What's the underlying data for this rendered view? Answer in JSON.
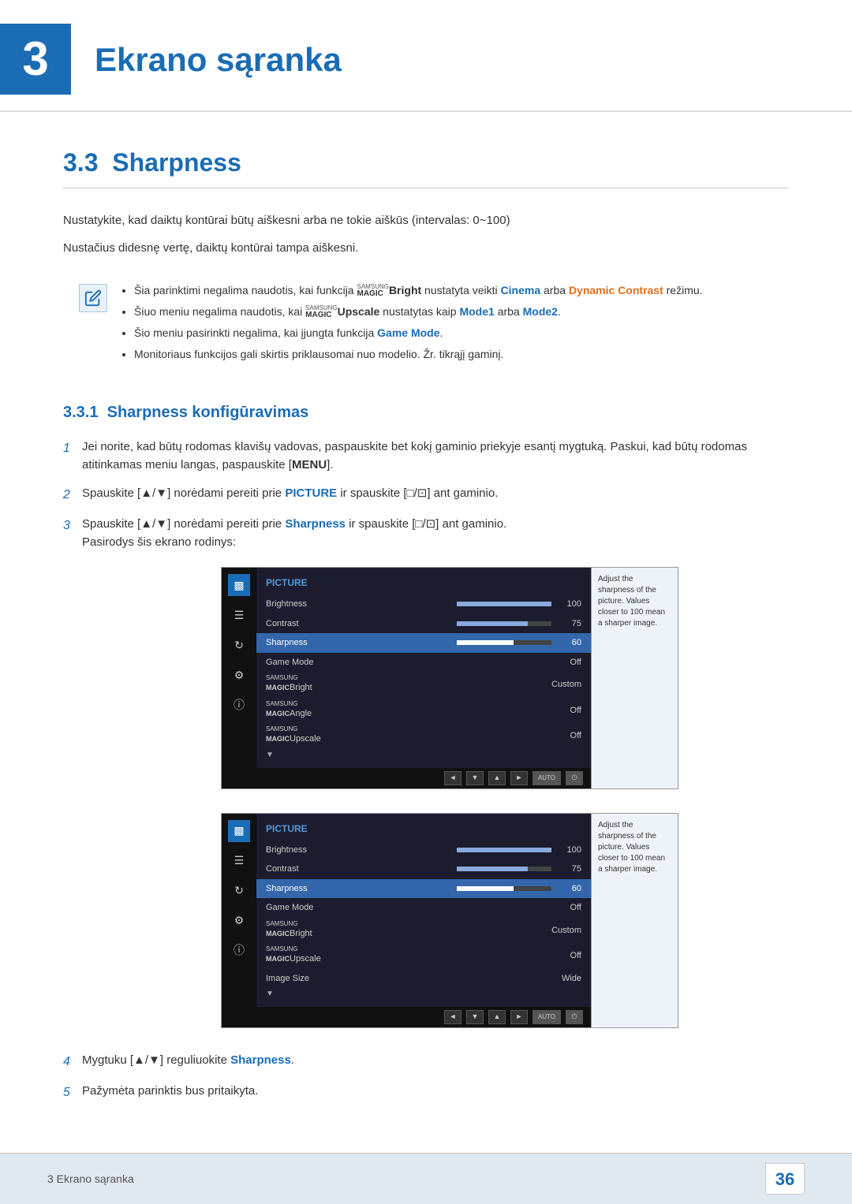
{
  "chapter": {
    "number": "3",
    "title": "Ekrano sąranka"
  },
  "section": {
    "number": "3.3",
    "title": "Sharpness"
  },
  "intro_lines": [
    "Nustatykite, kad daiktų kontūrai būtų aiškesni arba ne tokie aiškūs (intervalas: 0~100)",
    "Nustačius didesnę vertę, daiktų kontūrai tampa aiškesni."
  ],
  "notes": [
    "Šia parinktimi negalima naudotis, kai funkcija SAMSUNGBright nustatyta veikti Cinema arba Dynamic Contrast režimu.",
    "Šiuo meniu negalima naudotis, kai SAMSUNGUpscale nustatytas kaip Mode1 arba Mode2.",
    "Šio meniu pasirinkti negalima, kai įjungta funkcija Game Mode.",
    "Monitoriaus funkcijos gali skirtis priklausomai nuo modelio. Žr. tikrąjį gaminį."
  ],
  "subsection": {
    "number": "3.3.1",
    "title": "Sharpness konfigūravimas"
  },
  "steps": [
    {
      "num": "1",
      "text": "Jei norite, kad būtų rodomas klavišų vadovas, paspauskite bet kokį gaminio priekyje esantį mygtuką. Paskui, kad būtų rodomas atitinkamas meniu langas, paspauskite [MENU]."
    },
    {
      "num": "2",
      "text": "Spauskite [▲/▼] norėdami pereiti prie PICTURE ir spauskite [□/⊡] ant gaminio."
    },
    {
      "num": "3",
      "text": "Spauskite [▲/▼] norėdami pereiti prie Sharpness ir spauskite [□/⊡] ant gaminio.",
      "sub": "Pasirodys šis ekrano rodinys:"
    },
    {
      "num": "4",
      "text": "Mygtuku [▲/▼] reguliuokite Sharpness."
    },
    {
      "num": "5",
      "text": "Pažymėta parinktis bus pritaikyta."
    }
  ],
  "osd_screen1": {
    "title": "PICTURE",
    "items": [
      {
        "name": "Brightness",
        "bar": true,
        "bar_fill": 100,
        "value": "100",
        "highlighted": false
      },
      {
        "name": "Contrast",
        "bar": true,
        "bar_fill": 75,
        "value": "75",
        "highlighted": false
      },
      {
        "name": "Sharpness",
        "bar": true,
        "bar_fill": 60,
        "value": "60",
        "highlighted": true
      },
      {
        "name": "Game Mode",
        "bar": false,
        "value": "Off",
        "highlighted": false
      },
      {
        "name": "SAMSUNGBright",
        "bar": false,
        "value": "Custom",
        "highlighted": false
      },
      {
        "name": "SAMSUNGAngle",
        "bar": false,
        "value": "Off",
        "highlighted": false
      },
      {
        "name": "SAMSUNGUpscale",
        "bar": false,
        "value": "Off",
        "highlighted": false
      }
    ],
    "help": "Adjust the sharpness of the picture. Values closer to 100 mean a sharper image."
  },
  "osd_screen2": {
    "title": "PICTURE",
    "items": [
      {
        "name": "Brightness",
        "bar": true,
        "bar_fill": 100,
        "value": "100",
        "highlighted": false
      },
      {
        "name": "Contrast",
        "bar": true,
        "bar_fill": 75,
        "value": "75",
        "highlighted": false
      },
      {
        "name": "Sharpness",
        "bar": true,
        "bar_fill": 60,
        "value": "60",
        "highlighted": true
      },
      {
        "name": "Game Mode",
        "bar": false,
        "value": "Off",
        "highlighted": false
      },
      {
        "name": "SAMSUNGBright",
        "bar": false,
        "value": "Custom",
        "highlighted": false
      },
      {
        "name": "SAMSUNGUpscale",
        "bar": false,
        "value": "Off",
        "highlighted": false
      },
      {
        "name": "Image Size",
        "bar": false,
        "value": "Wide",
        "highlighted": false
      }
    ],
    "help": "Adjust the sharpness of the picture. Values closer to 100 mean a sharper image."
  },
  "footer": {
    "chapter_label": "3 Ekrano sąranka",
    "page_number": "36"
  }
}
